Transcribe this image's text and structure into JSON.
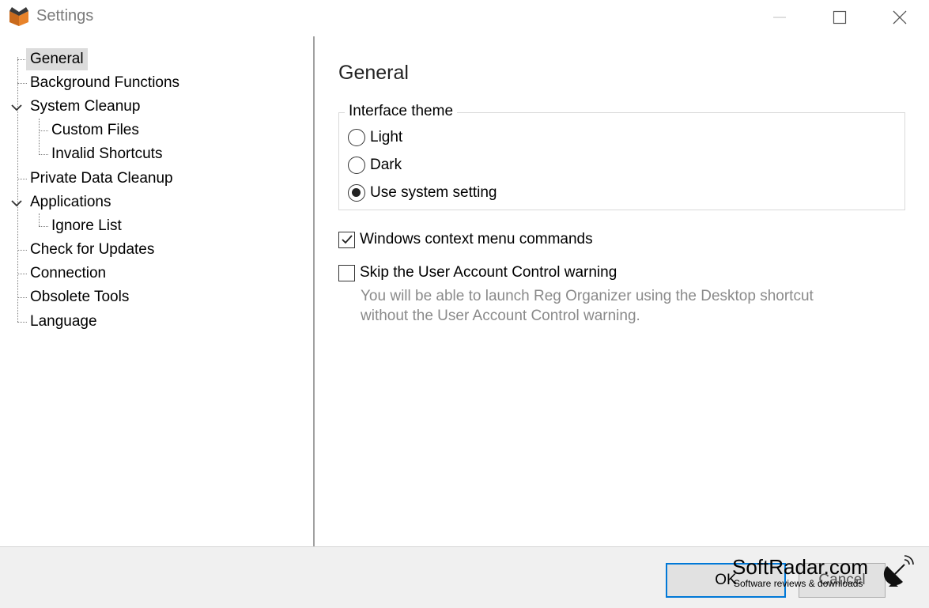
{
  "window": {
    "title": "Settings"
  },
  "tree": {
    "items": [
      {
        "label": "General",
        "selected": true
      },
      {
        "label": "Background Functions"
      },
      {
        "label": "System Cleanup",
        "expanded": true
      },
      {
        "label": "Custom Files"
      },
      {
        "label": "Invalid Shortcuts"
      },
      {
        "label": "Private Data Cleanup"
      },
      {
        "label": "Applications",
        "expanded": true
      },
      {
        "label": "Ignore List"
      },
      {
        "label": "Check for Updates"
      },
      {
        "label": "Connection"
      },
      {
        "label": "Obsolete Tools"
      },
      {
        "label": "Language"
      }
    ]
  },
  "panel": {
    "title": "General",
    "theme_group": {
      "legend": "Interface theme",
      "options": [
        {
          "label": "Light",
          "checked": false
        },
        {
          "label": "Dark",
          "checked": false
        },
        {
          "label": "Use system setting",
          "checked": true
        }
      ]
    },
    "context_menu": {
      "label": "Windows context menu commands",
      "checked": true
    },
    "uac": {
      "label": "Skip the User Account Control warning",
      "checked": false
    },
    "uac_hint_line1": "You will be able to launch Reg Organizer using the Desktop shortcut",
    "uac_hint_line2": "without the User Account Control warning."
  },
  "buttons": {
    "ok": "OK",
    "cancel": "Cancel"
  },
  "watermark": {
    "main": "SoftRadar.com",
    "sub": "Software reviews & downloads"
  },
  "colors": {
    "accent": "#0078d7",
    "selection": "#dcdcdc",
    "app_icon": "#e8832a"
  },
  "icons": [
    "app-logo-icon",
    "minimize-icon",
    "maximize-icon",
    "close-icon",
    "chevron-down-icon",
    "checkmark-icon",
    "satellite-dish-icon"
  ]
}
